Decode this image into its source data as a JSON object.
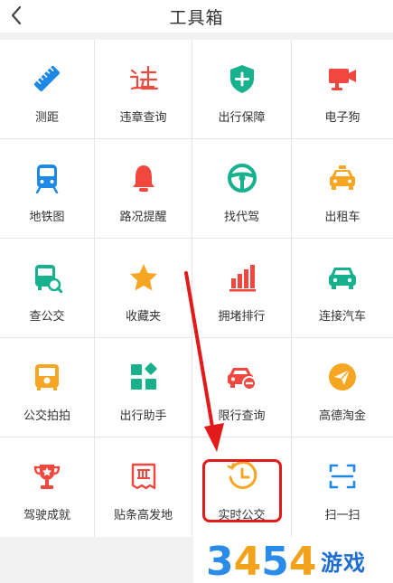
{
  "header": {
    "title": "工具箱"
  },
  "tools": [
    {
      "label": "测距",
      "icon": "ruler-icon"
    },
    {
      "label": "违章查询",
      "icon": "violation-icon"
    },
    {
      "label": "出行保障",
      "icon": "shield-plus-icon"
    },
    {
      "label": "电子狗",
      "icon": "camera-icon"
    },
    {
      "label": "地铁图",
      "icon": "metro-icon"
    },
    {
      "label": "路况提醒",
      "icon": "bell-icon"
    },
    {
      "label": "找代驾",
      "icon": "steering-wheel-icon"
    },
    {
      "label": "出租车",
      "icon": "taxi-icon"
    },
    {
      "label": "查公交",
      "icon": "bus-search-icon"
    },
    {
      "label": "收藏夹",
      "icon": "star-icon"
    },
    {
      "label": "拥堵排行",
      "icon": "bar-chart-icon"
    },
    {
      "label": "连接汽车",
      "icon": "car-icon"
    },
    {
      "label": "公交拍拍",
      "icon": "bus-photo-icon"
    },
    {
      "label": "出行助手",
      "icon": "apps-icon"
    },
    {
      "label": "限行查询",
      "icon": "restricted-car-icon"
    },
    {
      "label": "高德淘金",
      "icon": "paper-plane-icon"
    },
    {
      "label": "驾驶成就",
      "icon": "trophy-icon"
    },
    {
      "label": "贴条高发地",
      "icon": "ticket-icon"
    },
    {
      "label": "实时公交",
      "icon": "clock-icon"
    },
    {
      "label": "扫一扫",
      "icon": "scan-icon"
    }
  ],
  "watermark": {
    "digits": "3454",
    "text": "游戏"
  },
  "colors": {
    "blue": "#1e88e5",
    "red": "#f0483e",
    "green": "#17b18d",
    "orange": "#f6a623",
    "highlight": "#e21a1a",
    "arrow": "#e21a1a",
    "watermark_blue": "#1e6dd1"
  }
}
